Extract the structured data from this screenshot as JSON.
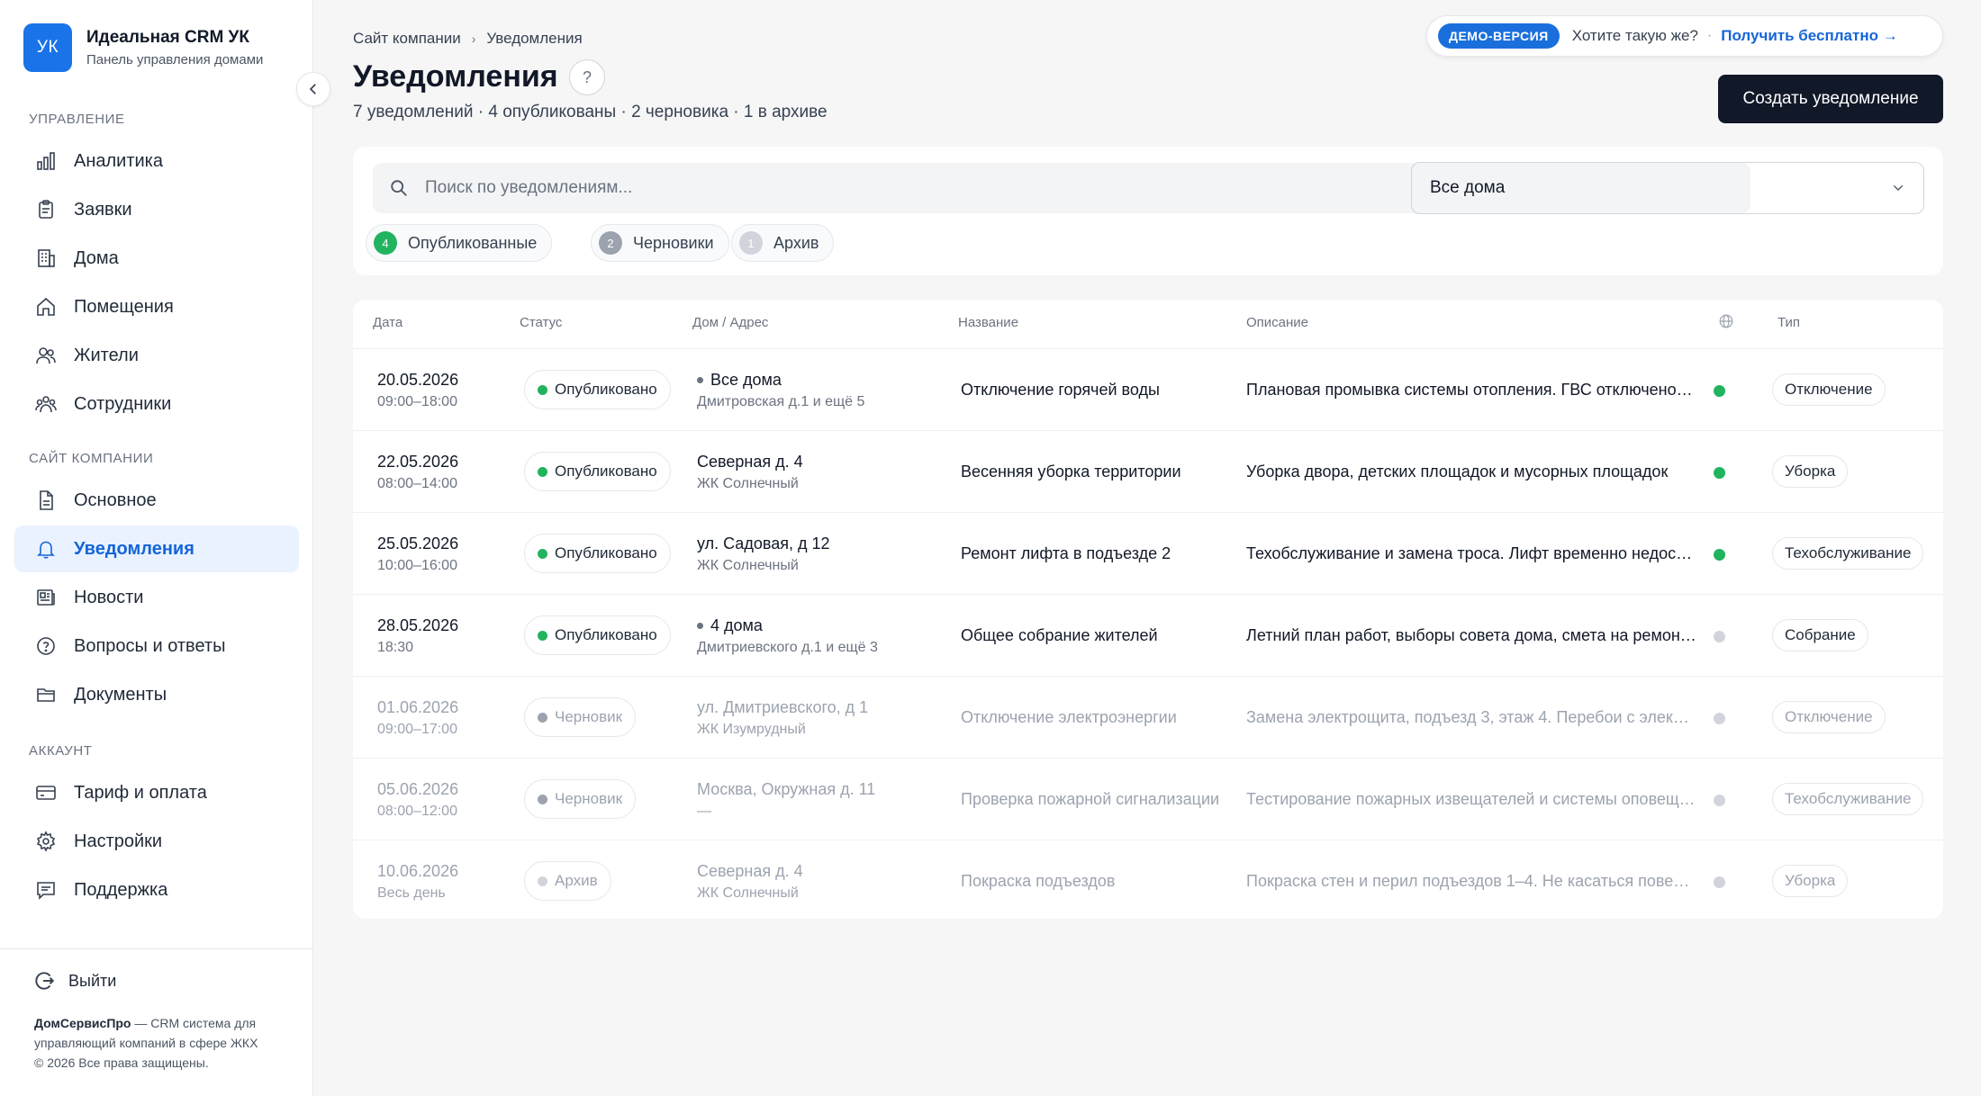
{
  "brand": {
    "logo": "УК",
    "title": "Идеальная CRM УК",
    "subtitle": "Панель управления домами"
  },
  "sidebar": {
    "sections": [
      {
        "title": "Управление"
      },
      {
        "title": "Сайт компании"
      },
      {
        "title": "Аккаунт"
      }
    ],
    "items": [
      {
        "label": "Аналитика",
        "icon": "chart-icon"
      },
      {
        "label": "Заявки",
        "icon": "clipboard-icon"
      },
      {
        "label": "Дома",
        "icon": "building-icon"
      },
      {
        "label": "Помещения",
        "icon": "home-icon"
      },
      {
        "label": "Жители",
        "icon": "residents-icon"
      },
      {
        "label": "Сотрудники",
        "icon": "staff-icon"
      },
      {
        "label": "Основное",
        "icon": "document-icon"
      },
      {
        "label": "Уведомления",
        "icon": "bell-icon",
        "active": true
      },
      {
        "label": "Новости",
        "icon": "news-icon"
      },
      {
        "label": "Вопросы и ответы",
        "icon": "question-icon"
      },
      {
        "label": "Документы",
        "icon": "folder-icon"
      },
      {
        "label": "Тариф и оплата",
        "icon": "card-icon"
      },
      {
        "label": "Настройки",
        "icon": "gear-icon"
      },
      {
        "label": "Поддержка",
        "icon": "chat-icon"
      }
    ],
    "logout": "Выйти",
    "footer_brand": "ДомСервисПро",
    "footer_text": " — CRM система для управляющий компаний в сфере ЖКХ",
    "footer_copy": "© 2026 Все права защищены."
  },
  "header": {
    "breadcrumb": [
      "Сайт компании",
      "Уведомления"
    ],
    "title": "Уведомления",
    "help": "?",
    "subtitle": "7 уведомлений · 4 опубликованы · 2 черновика · 1 в архиве",
    "demo_badge": "ДЕМО-ВЕРСИЯ",
    "demo_question": "Хотите такую же?",
    "demo_sep": "·",
    "demo_link": "Получить бесплатно →",
    "create_button": "Создать уведомление"
  },
  "filters": {
    "search_placeholder": "Поиск по уведомлениям...",
    "houses_select": "Все дома",
    "chips": [
      {
        "count": "4",
        "label": "Опубликованные",
        "color": "#22b35e"
      },
      {
        "count": "2",
        "label": "Черновики",
        "color": "#9ca3af"
      },
      {
        "count": "1",
        "label": "Архив",
        "color": "#d1d5db"
      }
    ]
  },
  "table": {
    "columns": [
      "Дата",
      "Статус",
      "Дом / Адрес",
      "Название",
      "Описание",
      "globe-icon",
      "Тип"
    ],
    "rows": [
      {
        "date": "20.05.2026",
        "time": "09:00–18:00",
        "status": "Опубликовано",
        "status_color": "#22b35e",
        "addr": "Все дома",
        "addr_bullet": true,
        "addr_sub": "Дмитровская д.1 и ещё 5",
        "name": "Отключение горячей воды",
        "desc": "Плановая промывка системы отопления. ГВС отключено на весь день",
        "published_color": "#22b35e",
        "type": "Отключение",
        "muted": false
      },
      {
        "date": "22.05.2026",
        "time": "08:00–14:00",
        "status": "Опубликовано",
        "status_color": "#22b35e",
        "addr": "Северная д. 4",
        "addr_bullet": false,
        "addr_sub": "ЖК Солнечный",
        "name": "Весенняя уборка территории",
        "desc": "Уборка двора, детских площадок и мусорных площадок",
        "published_color": "#22b35e",
        "type": "Уборка",
        "muted": false
      },
      {
        "date": "25.05.2026",
        "time": "10:00–16:00",
        "status": "Опубликовано",
        "status_color": "#22b35e",
        "addr": "ул. Садовая, д 12",
        "addr_bullet": false,
        "addr_sub": "ЖК Солнечный",
        "name": "Ремонт лифта в подъезде 2",
        "desc": "Техобслуживание и замена троса. Лифт временно недоступен",
        "published_color": "#22b35e",
        "type": "Техобслуживание",
        "muted": false
      },
      {
        "date": "28.05.2026",
        "time": "18:30",
        "status": "Опубликовано",
        "status_color": "#22b35e",
        "addr": "4 дома",
        "addr_bullet": true,
        "addr_sub": "Дмитриевского д.1 и ещё 3",
        "name": "Общее собрание жителей",
        "desc": "Летний план работ, выборы совета дома, смета на ремонт подъездов",
        "published_color": "#d1d5db",
        "type": "Собрание",
        "muted": false
      },
      {
        "date": "01.06.2026",
        "time": "09:00–17:00",
        "status": "Черновик",
        "status_color": "#9ca3af",
        "addr": "ул. Дмитриевского, д 1",
        "addr_bullet": false,
        "addr_sub": "ЖК Изумрудный",
        "name": "Отключение электроэнергии",
        "desc": "Замена электрощита, подъезд 3, этаж 4. Перебои с электричеством",
        "published_color": "#d1d5db",
        "type": "Отключение",
        "muted": true
      },
      {
        "date": "05.06.2026",
        "time": "08:00–12:00",
        "status": "Черновик",
        "status_color": "#9ca3af",
        "addr": "Москва, Окружная д. 11",
        "addr_bullet": false,
        "addr_sub": "—",
        "name": "Проверка пожарной сигнализации",
        "desc": "Тестирование пожарных извещателей и системы оповещения",
        "published_color": "#d1d5db",
        "type": "Техобслуживание",
        "muted": true
      },
      {
        "date": "10.06.2026",
        "time": "Весь день",
        "status": "Архив",
        "status_color": "#d1d5db",
        "addr": "Северная д. 4",
        "addr_bullet": false,
        "addr_sub": "ЖК Солнечный",
        "name": "Покраска подъездов",
        "desc": "Покраска стен и перил подъездов 1–4. Не касаться поверхностей",
        "published_color": "#d1d5db",
        "type": "Уборка",
        "muted": true
      }
    ]
  }
}
